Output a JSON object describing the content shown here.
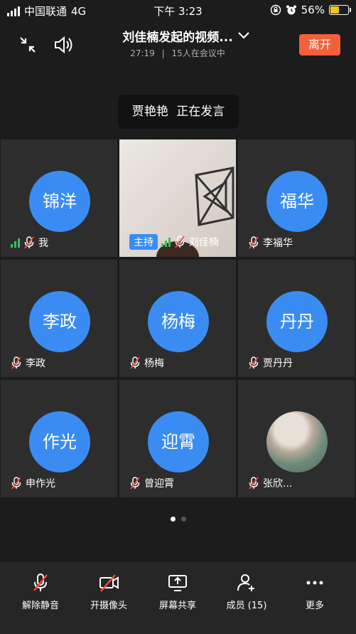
{
  "status_bar": {
    "carrier": "中国联通",
    "network": "4G",
    "time": "下午 3:23",
    "battery_percent": "56%",
    "battery_level": 0.56
  },
  "header": {
    "title": "刘佳楠发起的视频...",
    "duration": "27:19",
    "separator": "|",
    "participants_text": "15人在会议中",
    "leave_label": "离开"
  },
  "speaker_banner": {
    "name": "贾艳艳",
    "status": "正在发言"
  },
  "participants": [
    {
      "avatar_text": "锦洋",
      "name": "我",
      "signal": true,
      "host": false,
      "type": "avatar"
    },
    {
      "avatar_text": "",
      "name": "刘佳楠",
      "signal": true,
      "host": true,
      "host_label": "主持",
      "type": "video"
    },
    {
      "avatar_text": "福华",
      "name": "李福华",
      "signal": false,
      "host": false,
      "type": "avatar"
    },
    {
      "avatar_text": "李政",
      "name": "李政",
      "signal": false,
      "host": false,
      "type": "avatar"
    },
    {
      "avatar_text": "杨梅",
      "name": "杨梅",
      "signal": false,
      "host": false,
      "type": "avatar"
    },
    {
      "avatar_text": "丹丹",
      "name": "贾丹丹",
      "signal": false,
      "host": false,
      "type": "avatar"
    },
    {
      "avatar_text": "作光",
      "name": "申作光",
      "signal": false,
      "host": false,
      "type": "avatar"
    },
    {
      "avatar_text": "迎霄",
      "name": "曾迎霄",
      "signal": false,
      "host": false,
      "type": "avatar"
    },
    {
      "avatar_text": "",
      "name": "张欣...",
      "signal": false,
      "host": false,
      "type": "photo"
    }
  ],
  "pager": {
    "pages": 2,
    "current": 1
  },
  "toolbar": {
    "unmute": "解除静音",
    "camera": "开摄像头",
    "share": "屏幕共享",
    "members": "成员 (15)",
    "more": "更多"
  },
  "colors": {
    "background": "#1c1c1c",
    "tile": "#2d2d2d",
    "avatar": "#3a8cf2",
    "leave": "#f2603c",
    "signal": "#3ac05a",
    "muted": "#ff4a3d"
  }
}
